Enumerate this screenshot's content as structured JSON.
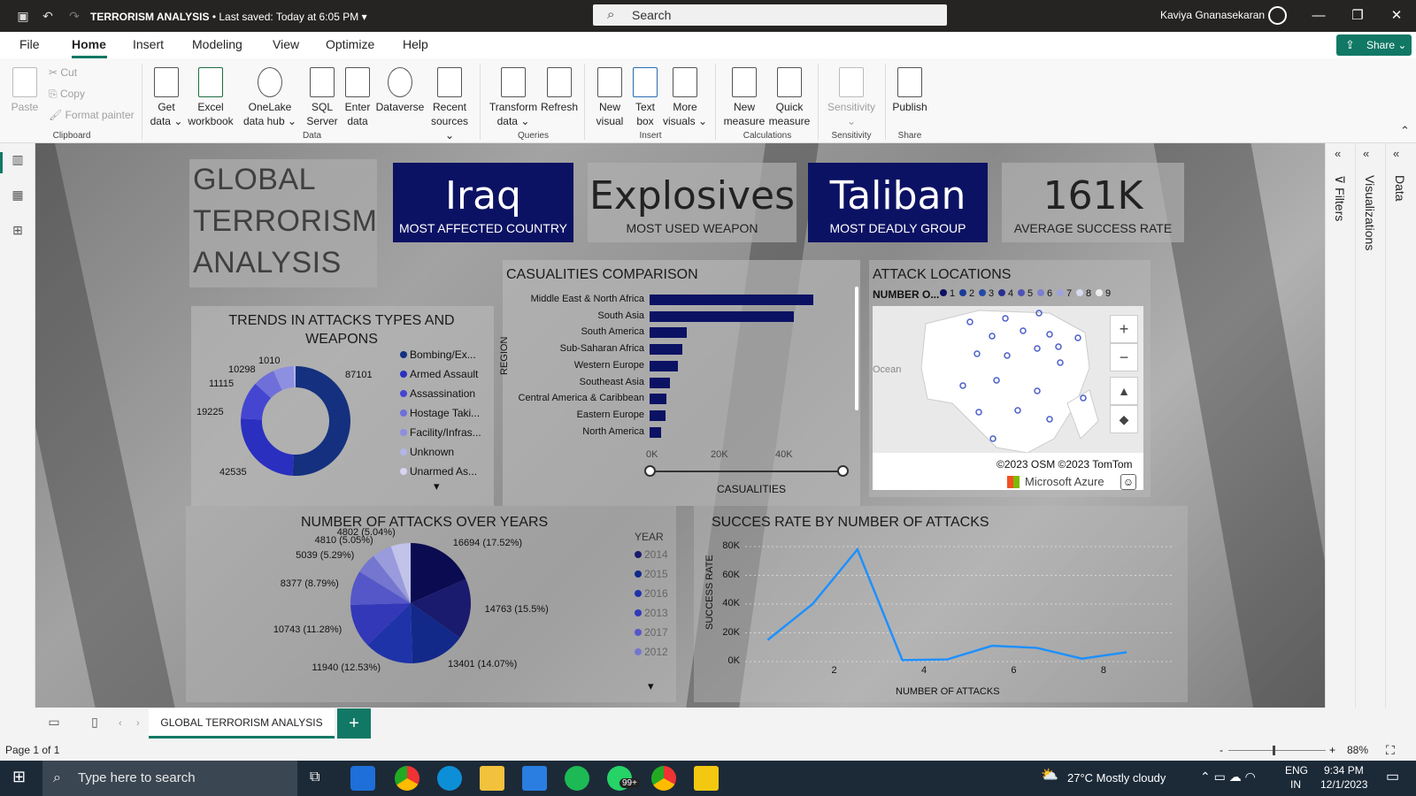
{
  "window": {
    "title": "TERRORISM ANALYSIS",
    "saved": "• Last saved: Today at 6:05 PM",
    "search_placeholder": "Search",
    "user": "Kaviya Gnanasekaran"
  },
  "menu": {
    "items": [
      "File",
      "Home",
      "Insert",
      "Modeling",
      "View",
      "Optimize",
      "Help"
    ],
    "share": "Share"
  },
  "ribbon": {
    "clipboard": {
      "paste": "Paste",
      "cut": "Cut",
      "copy": "Copy",
      "format_painter": "Format painter",
      "group": "Clipboard"
    },
    "data": {
      "get_data": "Get data ⌄",
      "excel": "Excel workbook",
      "onelake": "OneLake data hub ⌄",
      "sql": "SQL Server",
      "enter": "Enter data",
      "dataverse": "Dataverse",
      "recent": "Recent sources ⌄",
      "group": "Data"
    },
    "queries": {
      "transform": "Transform data ⌄",
      "refresh": "Refresh",
      "group": "Queries"
    },
    "insert": {
      "new_visual": "New visual",
      "text_box": "Text box",
      "more_visuals": "More visuals ⌄",
      "group": "Insert"
    },
    "calculations": {
      "new_measure": "New measure",
      "quick_measure": "Quick measure",
      "group": "Calculations"
    },
    "sensitivity": {
      "label": "Sensitivity ⌄",
      "group": "Sensitivity"
    },
    "share": {
      "publish": "Publish",
      "group": "Share"
    }
  },
  "panes": {
    "filters": "Filters",
    "visualizations": "Visualizations",
    "data": "Data"
  },
  "report": {
    "title_lines": [
      "GLOBAL",
      "TERRORISM",
      "ANALYSIS"
    ],
    "kpis": [
      {
        "value": "Iraq",
        "label": "MOST AFFECTED COUNTRY",
        "style": "dark"
      },
      {
        "value": "Explosives",
        "label": "MOST USED WEAPON",
        "style": "light"
      },
      {
        "value": "Taliban",
        "label": "MOST DEADLY GROUP",
        "style": "dark"
      },
      {
        "value": "161K",
        "label": "AVERAGE SUCCESS RATE",
        "style": "light"
      }
    ],
    "colors": {
      "navy": "#0c1263",
      "blue_line": "#1e90ff"
    }
  },
  "chart_data": [
    {
      "type": "pie",
      "title": "TRENDS IN ATTACKS TYPES AND WEAPONS",
      "donut": true,
      "categories": [
        "Bombing/Ex...",
        "Armed Assault",
        "Assassination",
        "Hostage Taki...",
        "Facility/Infras...",
        "Unknown",
        "Unarmed As..."
      ],
      "values": [
        87101,
        42535,
        19225,
        11115,
        10298,
        1010,
        0
      ],
      "data_labels": [
        "87101",
        "42535",
        "19225",
        "11115",
        "10298",
        "1010"
      ],
      "colors": [
        "#14307f",
        "#2a2fbf",
        "#4446d1",
        "#6e6fd8",
        "#8d8fe0",
        "#b3b4ea",
        "#d6d6f2"
      ]
    },
    {
      "type": "bar",
      "orientation": "horizontal",
      "title": "CASUALITIES COMPARISON",
      "xlabel": "CASUALITIES",
      "ylabel": "REGION",
      "categories": [
        "Middle East & North Africa",
        "South Asia",
        "South America",
        "Sub-Saharan Africa",
        "Western Europe",
        "Southeast Asia",
        "Central America & Caribbean",
        "Eastern Europe",
        "North America"
      ],
      "values": [
        50500,
        44500,
        11500,
        10000,
        8800,
        6300,
        5300,
        5000,
        3500
      ],
      "xticks": [
        "0K",
        "20K",
        "40K"
      ],
      "xlim": [
        0,
        60000
      ]
    },
    {
      "type": "pie",
      "title": "NUMBER OF ATTACKS OVER YEARS",
      "legend_title": "YEAR",
      "categories": [
        "2014",
        "2015",
        "2016",
        "2013",
        "2017",
        "2012"
      ],
      "values": [
        16694,
        14763,
        13401,
        11940,
        10743,
        8377,
        5039,
        4810,
        4802
      ],
      "data_labels": [
        "16694 (17.52%)",
        "14763 (15.5%)",
        "13401 (14.07%)",
        "11940 (12.53%)",
        "10743 (11.28%)",
        "8377 (8.79%)",
        "5039 (5.29%)",
        "4810 (5.05%)",
        "4802 (5.04%)"
      ],
      "colors": [
        "#0b0b52",
        "#1a1b6e",
        "#12298a",
        "#1f33a8",
        "#3338b8",
        "#5557c8",
        "#7476d0",
        "#9a9bdc",
        "#c2c3ea"
      ]
    },
    {
      "type": "line",
      "title": "SUCCES RATE BY NUMBER OF ATTACKS",
      "xlabel": "NUMBER OF ATTACKS",
      "ylabel": "SUCCESS RATE",
      "x": [
        0.5,
        1.5,
        2.5,
        3.5,
        4.5,
        5.5,
        6.5,
        7.5,
        8.5
      ],
      "values": [
        15000,
        40000,
        78000,
        1000,
        1500,
        11000,
        9500,
        2000,
        6500
      ],
      "xticks": [
        "2",
        "4",
        "6",
        "8"
      ],
      "yticks": [
        "0K",
        "20K",
        "40K",
        "60K",
        "80K"
      ],
      "xlim": [
        0,
        9.5
      ],
      "ylim": [
        0,
        80000
      ]
    }
  ],
  "map": {
    "title": "ATTACK LOCATIONS",
    "legend_label": "NUMBER O...",
    "legend_values": [
      "1",
      "2",
      "3",
      "4",
      "5",
      "6",
      "7",
      "8",
      "9"
    ],
    "ocean_label": "Ocean",
    "copyright": "©2023 OSM  ©2023 TomTom",
    "provider": "Microsoft Azure"
  },
  "statusbar": {
    "page_tab": "GLOBAL TERRORISM ANALYSIS",
    "page_info": "Page 1 of 1",
    "zoom": "88%"
  },
  "taskbar": {
    "search": "Type here to search",
    "weather": "27°C  Mostly cloudy",
    "lang1": "ENG",
    "lang2": "IN",
    "time": "9:34 PM",
    "date": "12/1/2023",
    "badge": "99+"
  }
}
